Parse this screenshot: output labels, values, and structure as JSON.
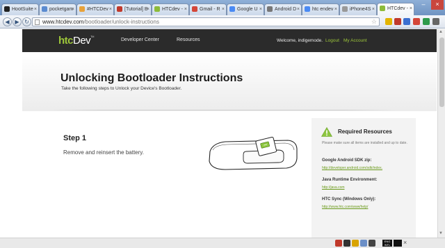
{
  "browser": {
    "tabs": [
      {
        "label": "HootSuite",
        "color": "#222222"
      },
      {
        "label": "pocketgam",
        "color": "#5b8bd0"
      },
      {
        "label": "#HTCDev",
        "color": "#e8a23a"
      },
      {
        "label": "[Tutorial] B",
        "color": "#c0392b"
      },
      {
        "label": "HTCdev -",
        "color": "#8dbb3a"
      },
      {
        "label": "Gmail - R",
        "color": "#d44638"
      },
      {
        "label": "Google U",
        "color": "#4a8af4"
      },
      {
        "label": "Android D",
        "color": "#777777"
      },
      {
        "label": "htc endev",
        "color": "#4a8af4"
      },
      {
        "label": "iPhone4S",
        "color": "#999999"
      },
      {
        "label": "HTCdev -",
        "color": "#8dbb3a"
      }
    ],
    "url_domain": "www.htcdev.com",
    "url_path": "/bootloader/unlock-instructions"
  },
  "site": {
    "logo_main": "htc",
    "logo_dev": "Dev",
    "logo_tm": "TM",
    "nav": [
      "Developer Center",
      "Resources"
    ],
    "welcome": "Welcome, indigemode.",
    "logout": "Logout",
    "my_account": "My Account"
  },
  "hero": {
    "title": "Unlocking Bootloader Instructions",
    "subtitle": "Take the following steps to Unlock your Device's Bootloader."
  },
  "step": {
    "title": "Step 1",
    "text": "Remove and reinsert the battery."
  },
  "sidebar": {
    "title": "Required Resources",
    "note": "Please make sure all items are installed and up to date.",
    "resources": [
      {
        "label": "Google Android SDK zip:",
        "link": "http://developer.android.com/sdk/index."
      },
      {
        "label": "Java Runtime Environment:",
        "link": "http://java.com"
      },
      {
        "label": "HTC Sync (Windows Only):",
        "link": "http://www.htc.com/www/help/"
      }
    ]
  },
  "colors": {
    "accent_green": "#9dc63a",
    "header_dark": "#2b2b2b",
    "sidebar_bg": "#f3f3f3"
  },
  "taskbar": {
    "lang_top": "ENG",
    "lang_bottom": "INTL"
  }
}
